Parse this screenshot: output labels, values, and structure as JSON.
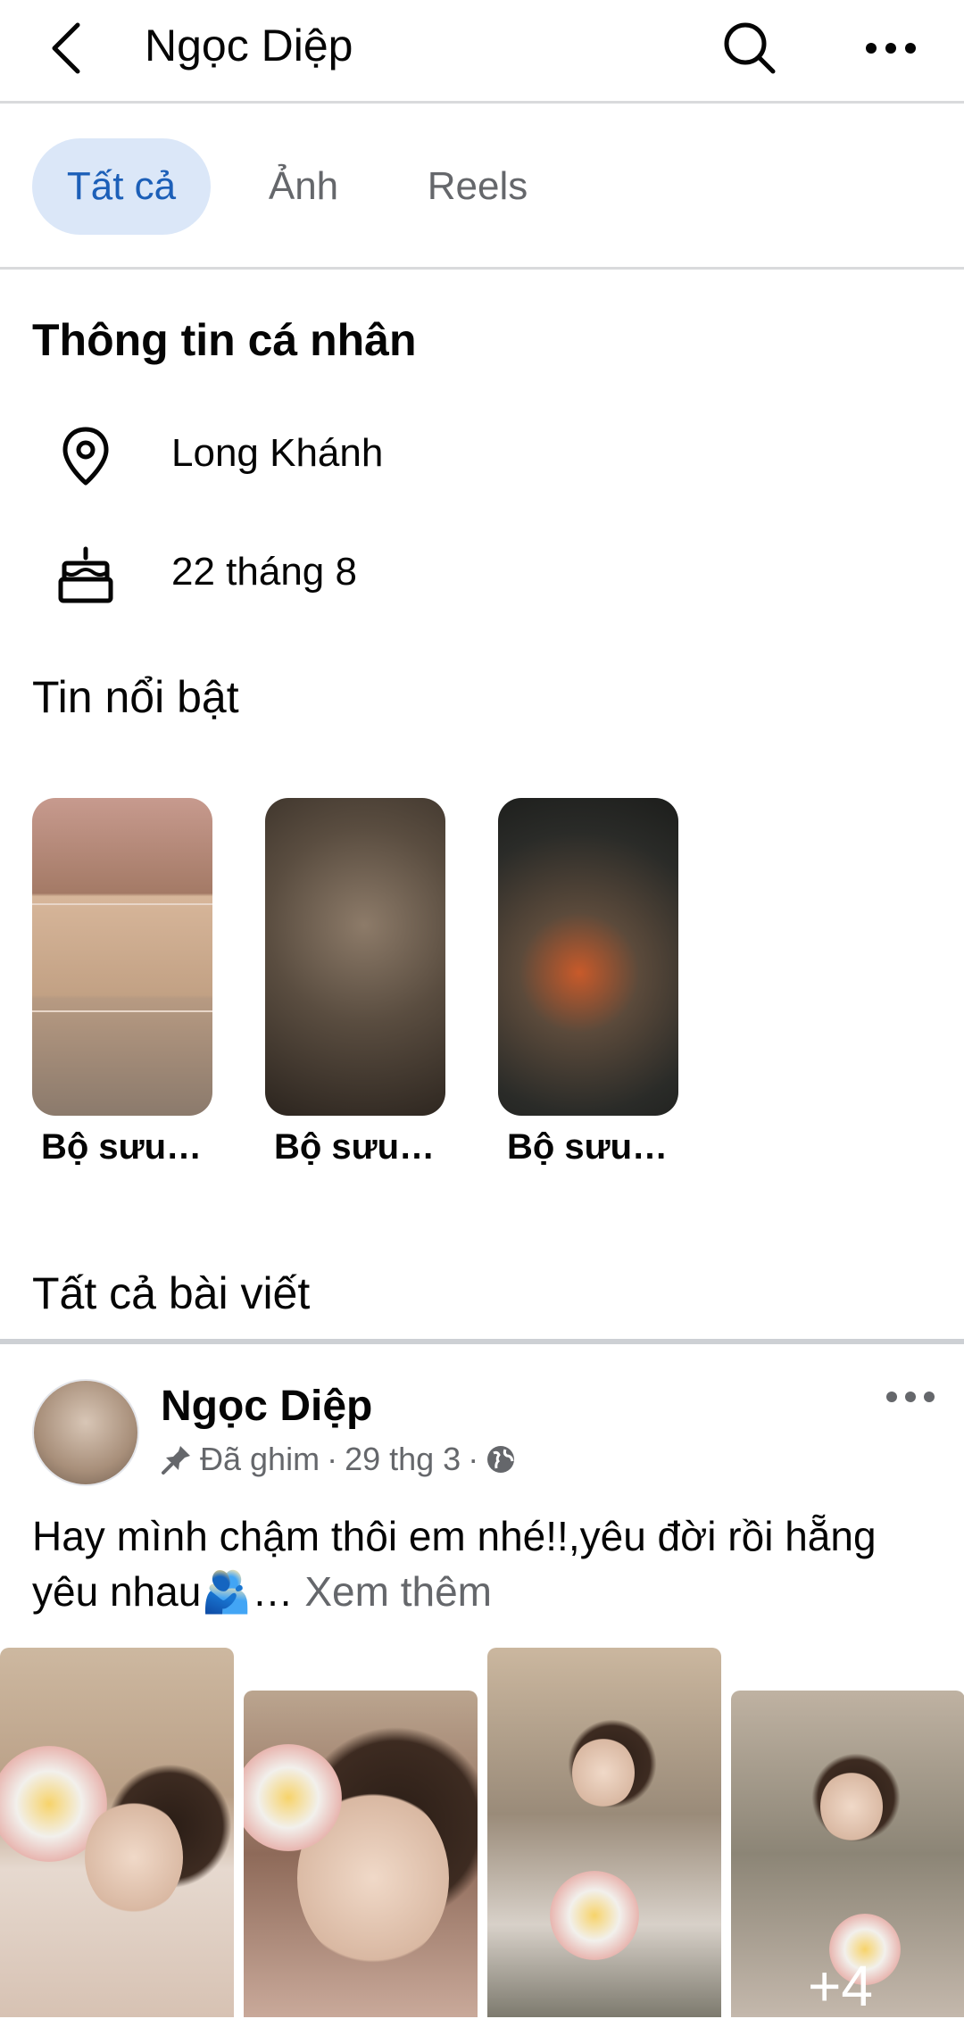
{
  "header": {
    "title": "Ngọc Diệp"
  },
  "tabs": [
    {
      "label": "Tất cả",
      "active": true
    },
    {
      "label": "Ảnh",
      "active": false
    },
    {
      "label": "Reels",
      "active": false
    }
  ],
  "personal_info": {
    "title": "Thông tin cá nhân",
    "location": "Long Khánh",
    "birthday": "22 tháng 8"
  },
  "highlights": {
    "title": "Tin nổi bật",
    "items": [
      {
        "label": "Bộ sưu…"
      },
      {
        "label": "Bộ sưu…"
      },
      {
        "label": "Bộ sưu…"
      }
    ]
  },
  "posts": {
    "title": "Tất cả bài viết",
    "items": [
      {
        "author": "Ngọc Diệp",
        "pinned_label": "Đã ghim",
        "date": "29 thg 3",
        "privacy_icon": "globe-icon",
        "text": "Hay mình chậm thôi em nhé!!,yêu đời rồi hẵng yêu nhau🫂…",
        "see_more": "Xem thêm",
        "more_photos": "+4"
      }
    ]
  },
  "colors": {
    "accent": "#1c5fb8",
    "active_tab_bg": "#dbe7f8",
    "muted_text": "#65676b",
    "divider": "#d9dadc"
  }
}
